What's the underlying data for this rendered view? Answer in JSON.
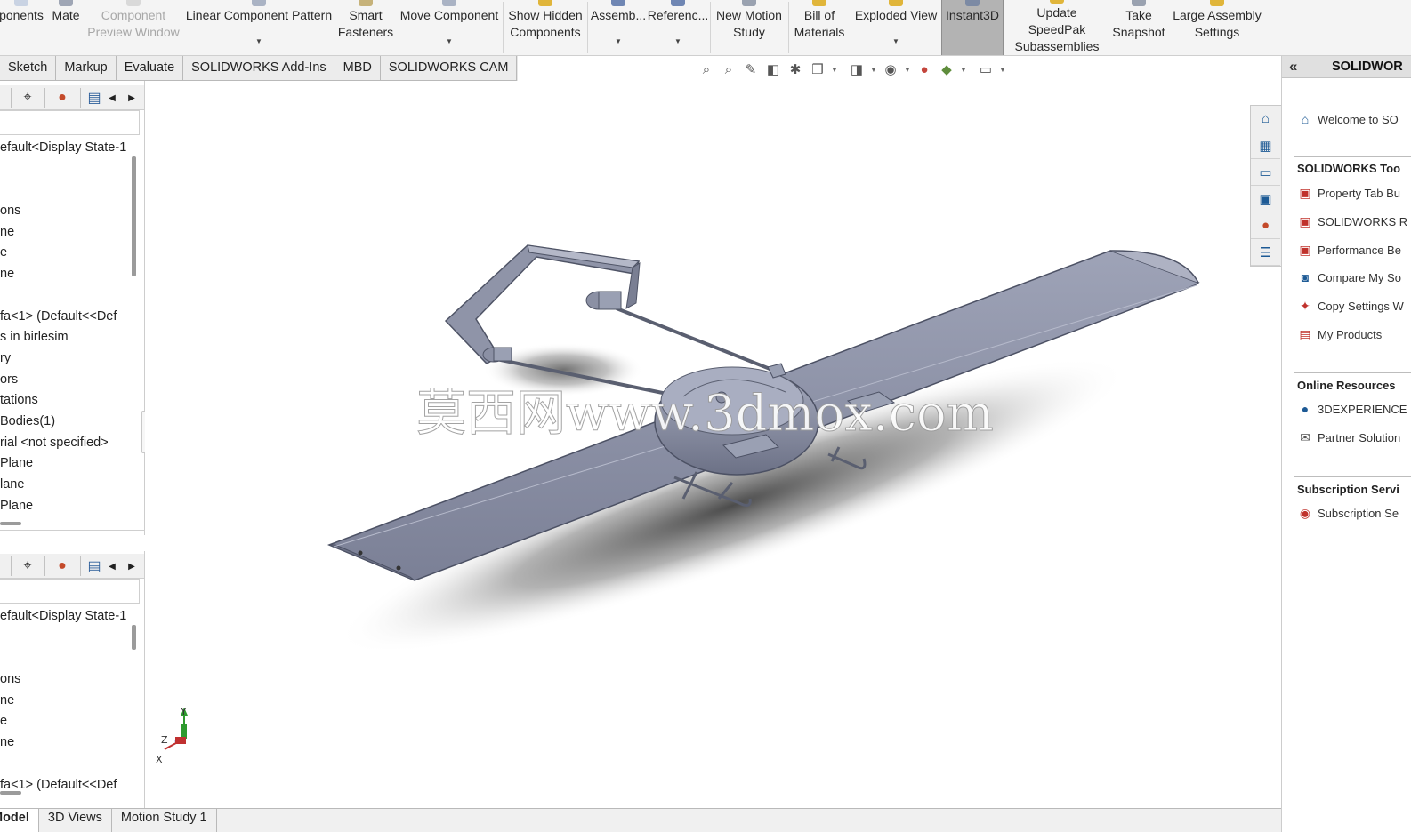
{
  "ribbon": {
    "buttons": [
      {
        "label": "ponents",
        "caret": false,
        "disabled": false,
        "active": false
      },
      {
        "label": "Mate",
        "caret": false,
        "disabled": false,
        "active": false
      },
      {
        "label": "Component\nPreview Window",
        "caret": false,
        "disabled": true,
        "active": false
      },
      {
        "label": "Linear Component Pattern",
        "caret": true,
        "disabled": false,
        "active": false
      },
      {
        "label": "Smart\nFasteners",
        "caret": false,
        "disabled": false,
        "active": false
      },
      {
        "label": "Move Component",
        "caret": true,
        "disabled": false,
        "active": false
      },
      {
        "label": "Show Hidden\nComponents",
        "caret": false,
        "disabled": false,
        "active": false
      },
      {
        "label": "Assemb...",
        "caret": true,
        "disabled": false,
        "active": false
      },
      {
        "label": "Referenc...",
        "caret": true,
        "disabled": false,
        "active": false
      },
      {
        "label": "New Motion\nStudy",
        "caret": false,
        "disabled": false,
        "active": false
      },
      {
        "label": "Bill of\nMaterials",
        "caret": false,
        "disabled": false,
        "active": false
      },
      {
        "label": "Exploded View",
        "caret": true,
        "disabled": false,
        "active": false
      },
      {
        "label": "Instant3D",
        "caret": false,
        "disabled": false,
        "active": true
      },
      {
        "label": "Update SpeedPak\nSubassemblies",
        "caret": false,
        "disabled": false,
        "active": false
      },
      {
        "label": "Take\nSnapshot",
        "caret": false,
        "disabled": false,
        "active": false
      },
      {
        "label": "Large Assembly\nSettings",
        "caret": false,
        "disabled": false,
        "active": false
      }
    ]
  },
  "tabs": [
    "Sketch",
    "Markup",
    "Evaluate",
    "SOLIDWORKS Add-Ins",
    "MBD",
    "SOLIDWORKS CAM"
  ],
  "tree_top": [
    "efault<Display State-1",
    "",
    "",
    "ons",
    "ne",
    "e",
    "ne",
    "",
    "fa<1> (Default<<Def",
    "s in birlesim",
    "ry",
    "ors",
    "tations",
    "Bodies(1)",
    "rial <not specified>",
    "Plane",
    "lane",
    "Plane"
  ],
  "tree_bottom": [
    "efault<Display State-1",
    "",
    "",
    "ons",
    "ne",
    "e",
    "ne",
    "",
    "fa<1> (Default<<Def"
  ],
  "watermark": "莫西网www.3dmox.com",
  "triad": {
    "x": "X",
    "y": "Y",
    "z": "Z"
  },
  "taskpane": {
    "title": "SOLIDWOR",
    "welcome": "Welcome to SO",
    "tools_heading": "SOLIDWORKS Too",
    "tools": [
      "Property Tab Bu",
      "SOLIDWORKS R",
      "Performance Be",
      "Compare My So",
      "Copy Settings W",
      "My Products"
    ],
    "online_heading": "Online Resources",
    "online": [
      "3DEXPERIENCE",
      "Partner Solution"
    ],
    "subscription_heading": "Subscription Servi",
    "subscription": [
      "Subscription Se"
    ]
  },
  "bottom_tabs": [
    {
      "label": "Model",
      "active": true
    },
    {
      "label": "3D Views",
      "active": false
    },
    {
      "label": "Motion Study 1",
      "active": false
    }
  ],
  "colors": {
    "model": "#8e94a8",
    "model_dark": "#5f6478",
    "accent": "#1d5a95",
    "ribbon_bg": "#f4f4f4",
    "active_btn": "#b3b3b3"
  }
}
